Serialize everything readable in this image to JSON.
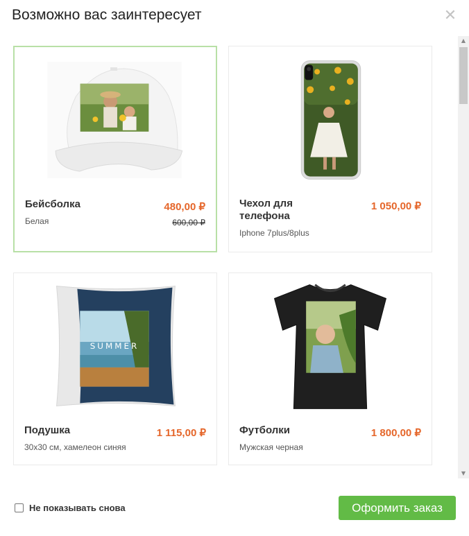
{
  "modal": {
    "title": "Возможно вас заинтересует",
    "close_icon": "close-icon"
  },
  "products": [
    {
      "name": "Бейсболка",
      "variant": "Белая",
      "price": "480,00 ₽",
      "old_price": "600,00 ₽",
      "selected": true,
      "image": "cap-photo-image"
    },
    {
      "name": "Чехол для телефона",
      "variant": "Iphone 7plus/8plus",
      "price": "1 050,00 ₽",
      "image": "phone-case-photo-image"
    },
    {
      "name": "Подушка",
      "variant": "30х30 см, хамелеон синяя",
      "price": "1 115,00 ₽",
      "image": "pillow-photo-image",
      "image_text": "SUMMER"
    },
    {
      "name": "Футболки",
      "variant": "Мужская черная",
      "price": "1 800,00 ₽",
      "image": "tshirt-photo-image"
    }
  ],
  "footer": {
    "dont_show_label": "Не показывать снова",
    "dont_show_checked": false,
    "order_button": "Оформить заказ"
  },
  "colors": {
    "accent_green": "#62bb46",
    "price_orange": "#e5662a",
    "selected_border": "#b8e0a6"
  }
}
